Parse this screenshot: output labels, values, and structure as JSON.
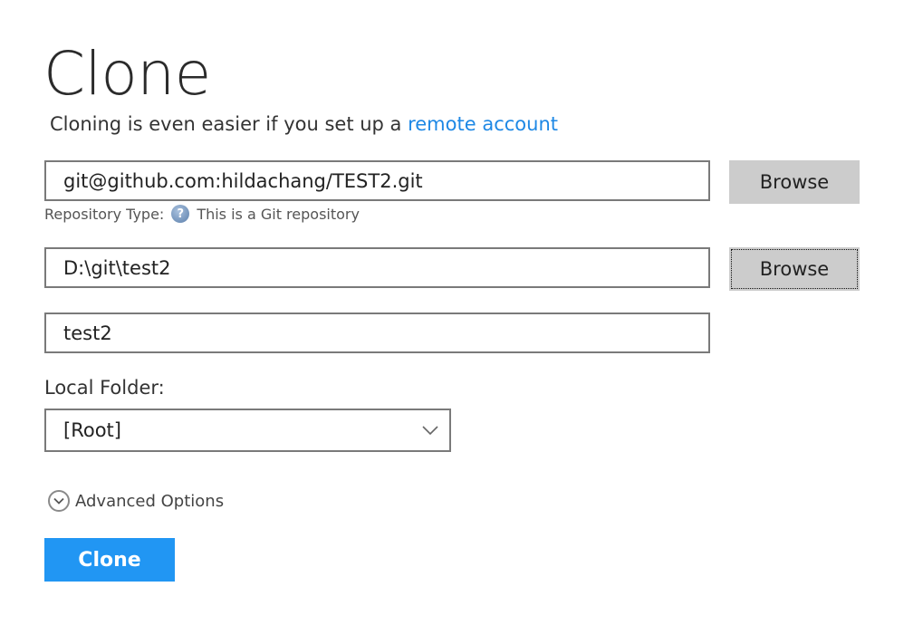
{
  "page": {
    "title": "Clone",
    "subtitle_prefix": "Cloning is even easier if you set up a ",
    "subtitle_link": "remote account"
  },
  "source": {
    "url_value": "git@github.com:hildachang/TEST2.git",
    "browse_label": "Browse",
    "repo_type_label": "Repository Type:",
    "repo_type_value": "This is a Git repository",
    "help_icon": "question-help-icon"
  },
  "destination": {
    "path_value": "D:\\git\\test2",
    "browse_label": "Browse"
  },
  "name": {
    "value": "test2"
  },
  "local_folder": {
    "label": "Local Folder:",
    "selected": "[Root]",
    "icon": "chevron-down-icon"
  },
  "advanced": {
    "label": "Advanced Options",
    "icon": "chevron-circle-down-icon"
  },
  "actions": {
    "clone_label": "Clone"
  },
  "colors": {
    "link": "#1e88e5",
    "primary_button": "#2196f3",
    "secondary_button": "#cccccc",
    "field_border": "#7a7a7a"
  }
}
